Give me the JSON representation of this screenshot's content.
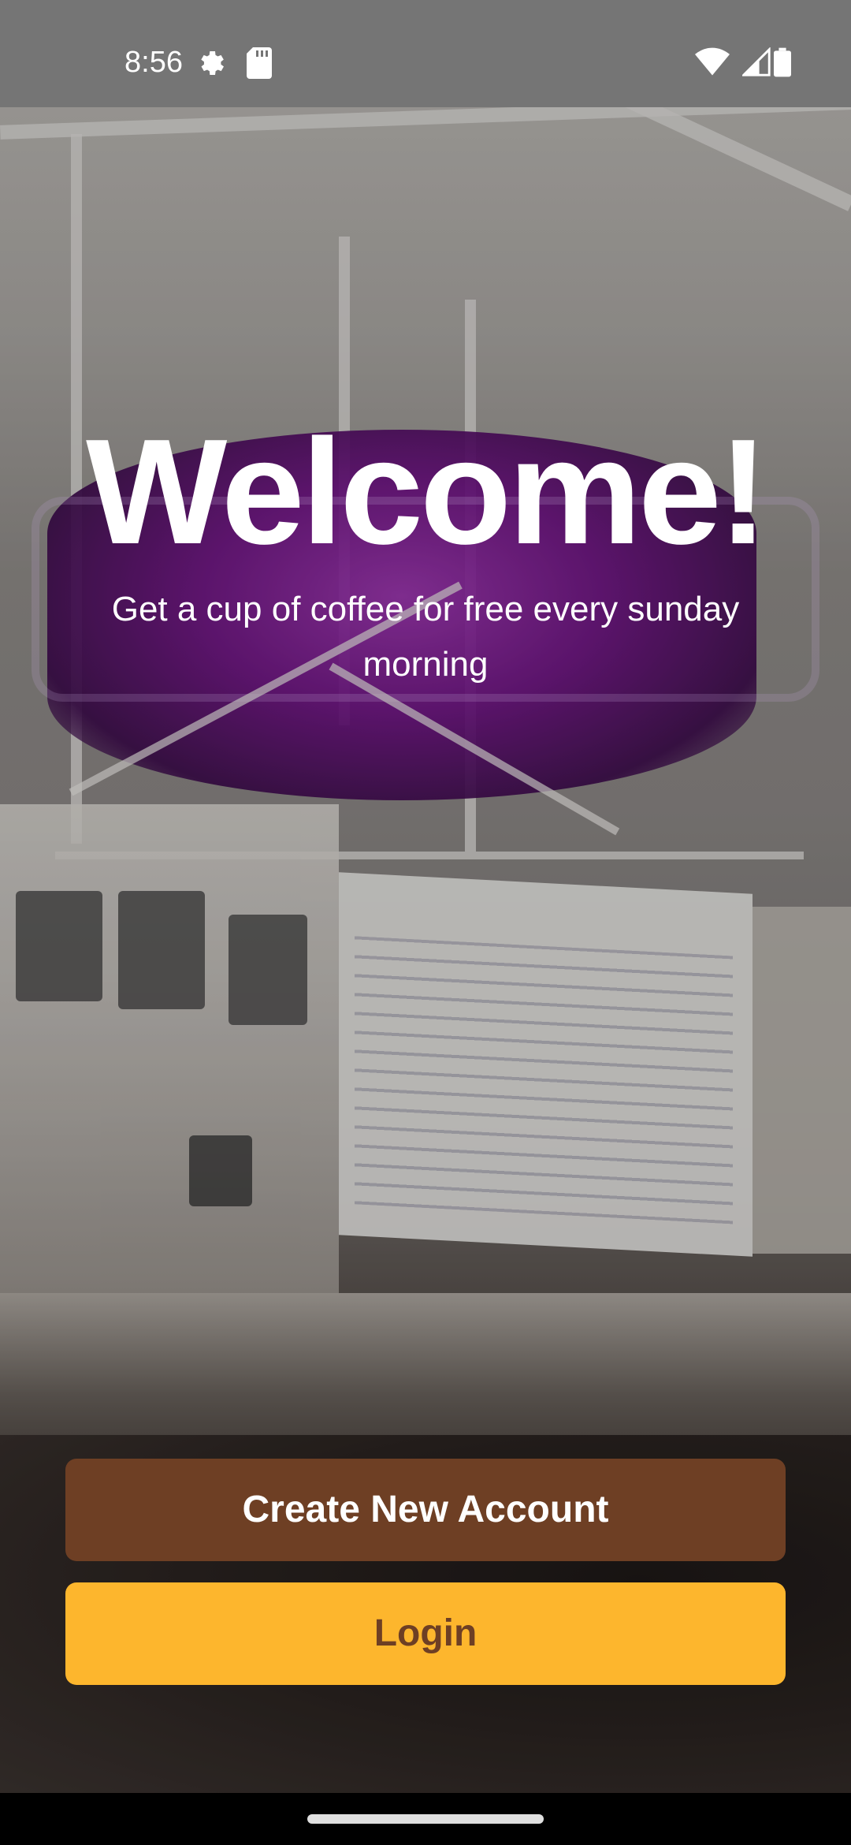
{
  "status_bar": {
    "time": "8:56",
    "icons": [
      "gear-icon",
      "sd-card-icon",
      "wifi-icon",
      "signal-icon",
      "battery-icon"
    ]
  },
  "hero": {
    "title": "Welcome!",
    "subtitle": "Get a cup of coffee for free every sunday morning"
  },
  "actions": {
    "create_account_label": "Create New Account",
    "login_label": "Login"
  },
  "colors": {
    "primary_brown": "#6e3f24",
    "accent_yellow": "#fdb62d",
    "status_bar": "#757575"
  }
}
